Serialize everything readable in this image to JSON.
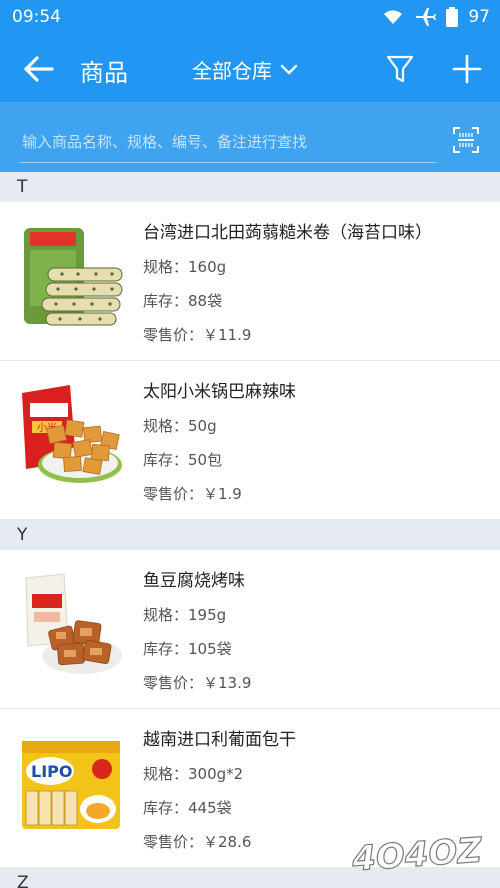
{
  "status": {
    "time": "09:54",
    "battery": "97"
  },
  "header": {
    "title": "商品",
    "warehouse": "全部仓库"
  },
  "search": {
    "placeholder": "输入商品名称、规格、编号、备注进行查找"
  },
  "sections": [
    {
      "letter": "T",
      "items": [
        {
          "name": "台湾进口北田蒟蒻糙米卷（海苔口味）",
          "spec": "规格：160g",
          "stock": "库存：88袋",
          "price": "零售价：￥11.9"
        },
        {
          "name": "太阳小米锅巴麻辣味",
          "spec": "规格：50g",
          "stock": "库存：50包",
          "price": "零售价：￥1.9"
        }
      ]
    },
    {
      "letter": "Y",
      "items": [
        {
          "name": "鱼豆腐烧烤味",
          "spec": "规格：195g",
          "stock": "库存：105袋",
          "price": "零售价：￥13.9"
        },
        {
          "name": "越南进口利葡面包干",
          "spec": "规格：300g*2",
          "stock": "库存：445袋",
          "price": "零售价：￥28.6"
        }
      ]
    },
    {
      "letter": "Z",
      "items": []
    }
  ],
  "images": {
    "lipo_text": "LIPO",
    "cracker_text": "小米"
  },
  "watermark": {
    "text": "4O4OZ"
  },
  "colors": {
    "primary": "#2196f3",
    "search_bg": "#40a3f0",
    "section_bg": "#e6ebf1"
  }
}
